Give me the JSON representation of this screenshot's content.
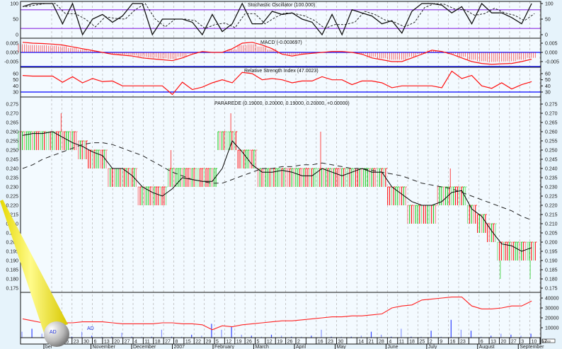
{
  "panels": {
    "stochastic": {
      "title": "Stochastic Oscillator (100.000)",
      "ticks": [
        "100",
        "50",
        "0"
      ],
      "tick_values": [
        100,
        50,
        0
      ],
      "levels": [
        80,
        20
      ]
    },
    "macd": {
      "title": "MACD (-0.003697)",
      "ticks": [
        "0.005",
        "0.000",
        "-0.005"
      ],
      "tick_values": [
        0.005,
        0,
        -0.005
      ]
    },
    "rsi": {
      "title": "Relative Strength Index (47.0023)",
      "ticks": [
        "60",
        "50",
        "40",
        "30"
      ],
      "tick_values": [
        60,
        50,
        40,
        30
      ],
      "level": 30
    },
    "price": {
      "title": "PARAREDE (0.19000, 0.20000, 0.19000, 0.20000, +0.00000)",
      "ticks": [
        "0.275",
        "0.270",
        "0.265",
        "0.260",
        "0.255",
        "0.250",
        "0.245",
        "0.240",
        "0.235",
        "0.230",
        "0.225",
        "0.220",
        "0.215",
        "0.210",
        "0.205",
        "0.200",
        "0.195",
        "0.190",
        "0.185",
        "0.180",
        "0.175"
      ]
    },
    "volume": {
      "title": "AD",
      "ticks": [
        "40000",
        "30000",
        "20000",
        "10000"
      ],
      "tick_values": [
        40000,
        30000,
        20000,
        10000
      ],
      "unit_label": "x1000"
    }
  },
  "date_axis": {
    "days": [
      "9",
      "16",
      "23",
      "30",
      "6",
      "13",
      "20",
      "27",
      "4",
      "11",
      "18",
      "27",
      "8",
      "15",
      "22",
      "29",
      "5",
      "12",
      "19",
      "26",
      "5",
      "12",
      "19",
      "26",
      "2",
      "",
      "16",
      "23",
      "30",
      "",
      "14",
      "21",
      "28",
      "4",
      "11",
      "18",
      "25",
      "2",
      "9",
      "16",
      "23",
      "",
      "6",
      "13",
      "20",
      "27",
      "3",
      "10",
      "17"
    ],
    "months": [
      {
        "label": "ber",
        "tick": 0
      },
      {
        "label": "November",
        "tick": 4
      },
      {
        "label": "December",
        "tick": 8
      },
      {
        "label": "2007",
        "tick": 12
      },
      {
        "label": "February",
        "tick": 16
      },
      {
        "label": "March",
        "tick": 20
      },
      {
        "label": "April",
        "tick": 24
      },
      {
        "label": "May",
        "tick": 28
      },
      {
        "label": "June",
        "tick": 33
      },
      {
        "label": "July",
        "tick": 37
      },
      {
        "label": "August",
        "tick": 42
      },
      {
        "label": "September",
        "tick": 46
      }
    ]
  },
  "colors": {
    "up": "#22cc22",
    "down": "#ff1111",
    "ma": "#000000",
    "level": "#8a2be2",
    "zero": "#0000ff",
    "volume": "#3344ff",
    "ad": "#ff2222"
  },
  "chart_data": {
    "type": "ohlc",
    "frequency": "weekly (approx.)",
    "ylim": [
      0.175,
      0.275
    ],
    "low": [
      0.25,
      0.25,
      0.25,
      0.25,
      0.25,
      0.25,
      0.245,
      0.24,
      0.24,
      0.23,
      0.23,
      0.23,
      0.22,
      0.22,
      0.22,
      0.23,
      0.23,
      0.23,
      0.23,
      0.23,
      0.25,
      0.25,
      0.24,
      0.24,
      0.23,
      0.23,
      0.23,
      0.23,
      0.23,
      0.23,
      0.23,
      0.23,
      0.23,
      0.23,
      0.23,
      0.23,
      0.23,
      0.22,
      0.22,
      0.21,
      0.21,
      0.21,
      0.22,
      0.22,
      0.22,
      0.21,
      0.205,
      0.2,
      0.19,
      0.19,
      0.19,
      0.19
    ],
    "high": [
      0.26,
      0.26,
      0.26,
      0.26,
      0.26,
      0.26,
      0.255,
      0.25,
      0.25,
      0.24,
      0.24,
      0.24,
      0.23,
      0.23,
      0.23,
      0.24,
      0.24,
      0.24,
      0.24,
      0.24,
      0.26,
      0.26,
      0.25,
      0.25,
      0.24,
      0.24,
      0.24,
      0.24,
      0.24,
      0.24,
      0.24,
      0.24,
      0.24,
      0.24,
      0.24,
      0.24,
      0.24,
      0.23,
      0.23,
      0.22,
      0.22,
      0.22,
      0.23,
      0.23,
      0.23,
      0.22,
      0.215,
      0.21,
      0.2,
      0.2,
      0.2,
      0.2
    ],
    "close": [
      0.258,
      0.259,
      0.259,
      0.26,
      0.257,
      0.254,
      0.252,
      0.249,
      0.247,
      0.24,
      0.24,
      0.236,
      0.23,
      0.227,
      0.225,
      0.229,
      0.235,
      0.234,
      0.233,
      0.233,
      0.24,
      0.255,
      0.249,
      0.242,
      0.238,
      0.238,
      0.239,
      0.238,
      0.236,
      0.236,
      0.24,
      0.238,
      0.236,
      0.238,
      0.24,
      0.238,
      0.238,
      0.23,
      0.226,
      0.222,
      0.22,
      0.22,
      0.222,
      0.227,
      0.228,
      0.218,
      0.214,
      0.206,
      0.199,
      0.198,
      0.195,
      0.197
    ],
    "ma_long": [
      0.24,
      0.242,
      0.245,
      0.247,
      0.249,
      0.251,
      0.253,
      0.254,
      0.254,
      0.253,
      0.251,
      0.249,
      0.247,
      0.244,
      0.241,
      0.238,
      0.236,
      0.234,
      0.233,
      0.232,
      0.232,
      0.234,
      0.236,
      0.238,
      0.24,
      0.24,
      0.241,
      0.241,
      0.242,
      0.242,
      0.243,
      0.242,
      0.241,
      0.24,
      0.24,
      0.239,
      0.238,
      0.237,
      0.236,
      0.234,
      0.232,
      0.231,
      0.23,
      0.229,
      0.227,
      0.225,
      0.223,
      0.221,
      0.219,
      0.217,
      0.214,
      0.212
    ],
    "spikes": [
      {
        "week": 4,
        "high": 0.27
      },
      {
        "week": 15,
        "high": 0.25
      },
      {
        "week": 21,
        "high": 0.27
      },
      {
        "week": 30,
        "high": 0.26
      },
      {
        "week": 43,
        "high": 0.24
      },
      {
        "week": 48,
        "low": 0.18
      },
      {
        "week": 51,
        "low": 0.18
      }
    ],
    "stochastic": [
      90,
      100,
      100,
      100,
      35,
      100,
      0,
      50,
      65,
      40,
      60,
      100,
      100,
      0,
      50,
      50,
      50,
      40,
      0,
      65,
      10,
      35,
      100,
      35,
      35,
      75,
      65,
      70,
      50,
      40,
      0,
      65,
      0,
      80,
      70,
      60,
      35,
      45,
      5,
      75,
      100,
      100,
      95,
      70,
      90,
      35,
      100,
      70,
      70,
      55,
      35,
      100
    ],
    "macd": [
      0.0055,
      0.005,
      0.0048,
      0.0045,
      0.004,
      0.003,
      0.002,
      0.001,
      0,
      -0.001,
      -0.0015,
      -0.002,
      -0.003,
      -0.0035,
      -0.004,
      -0.0045,
      -0.003,
      -0.001,
      0.0005,
      0,
      0,
      0.002,
      0.005,
      0.0055,
      0.004,
      0.002,
      -0.001,
      -0.002,
      -0.001,
      -0.0005,
      0,
      0.0005,
      0.0005,
      0,
      -0.001,
      -0.003,
      -0.004,
      -0.005,
      -0.005,
      -0.003,
      -0.001,
      0.0012,
      0.0005,
      -0.001,
      -0.003,
      -0.005,
      -0.006,
      -0.0065,
      -0.0062,
      -0.006,
      -0.005,
      -0.0037
    ],
    "rsi": [
      57,
      56,
      56,
      56,
      46,
      55,
      45,
      52,
      47,
      48,
      40,
      40,
      40,
      40,
      40,
      26,
      46,
      34,
      38,
      45,
      50,
      45,
      62,
      60,
      50,
      52,
      50,
      45,
      48,
      48,
      55,
      50,
      50,
      42,
      48,
      48,
      45,
      37,
      40,
      40,
      40,
      40,
      37,
      64,
      52,
      57,
      40,
      36,
      45,
      35,
      42,
      47
    ],
    "ad": [
      19000,
      17000,
      15000,
      16000,
      15000,
      15000,
      16000,
      16000,
      16000,
      15000,
      14000,
      14000,
      14000,
      14000,
      15000,
      15000,
      14000,
      14000,
      13000,
      8000,
      12000,
      11000,
      13000,
      14000,
      15000,
      16000,
      17000,
      17000,
      18000,
      19000,
      20000,
      21000,
      21000,
      22000,
      22000,
      23000,
      24000,
      30000,
      32000,
      33000,
      38000,
      39000,
      40000,
      41000,
      41000,
      32000,
      29000,
      29000,
      30000,
      32000,
      32000,
      37000
    ],
    "volume": [
      6000,
      9000,
      4000,
      2000,
      1000,
      1000,
      6000,
      2000,
      1000,
      1000,
      5000,
      1000,
      1000,
      1000,
      8000,
      1000,
      1000,
      3000,
      2000,
      14000,
      8000,
      11000,
      3000,
      2000,
      1000,
      3000,
      2000,
      1000,
      1000,
      2000,
      8000,
      1000,
      1000,
      1000,
      2000,
      6000,
      3000,
      1000,
      9000,
      1000,
      1000,
      7000,
      1000,
      18000,
      8000,
      7000,
      1000,
      2000,
      4000,
      3000,
      2000,
      4000
    ]
  }
}
